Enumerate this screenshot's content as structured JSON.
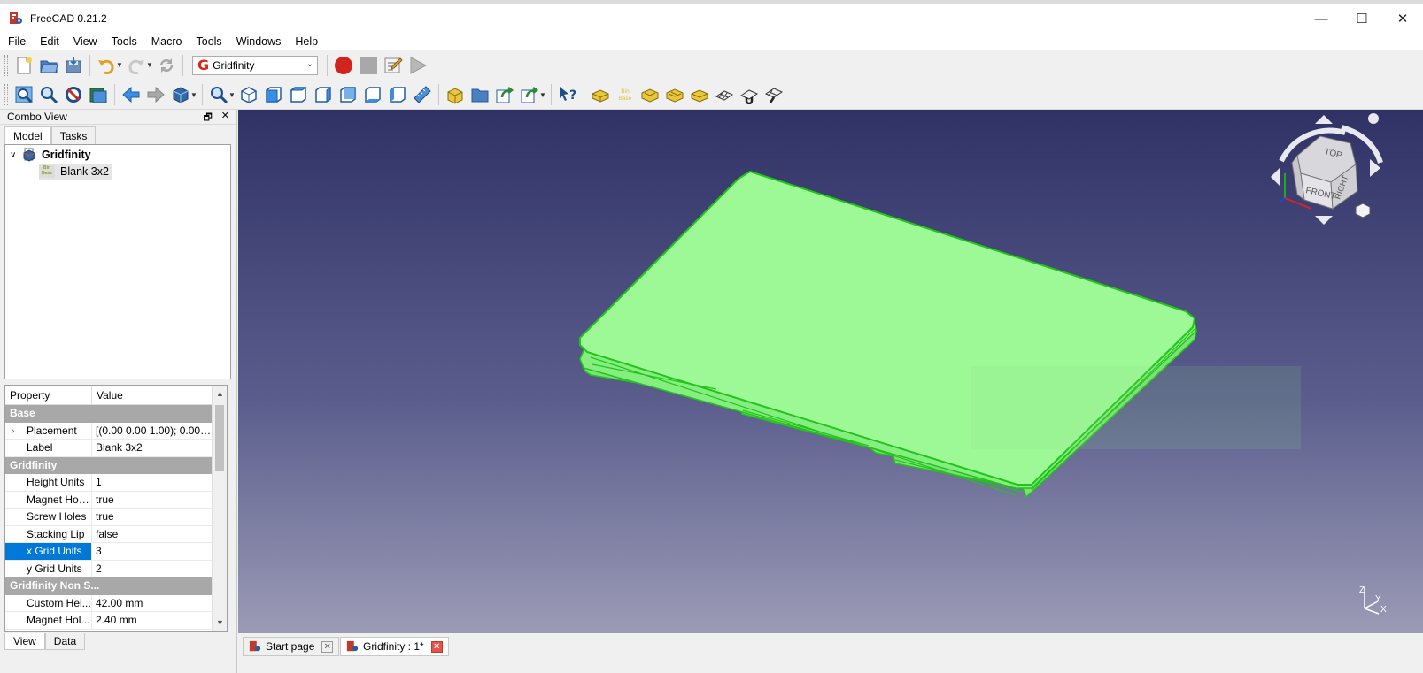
{
  "window": {
    "title": "FreeCAD 0.21.2",
    "minimize": "—",
    "maximize": "☐",
    "close": "✕"
  },
  "menu": [
    "File",
    "Edit",
    "View",
    "Tools",
    "Macro",
    "Tools",
    "Windows",
    "Help"
  ],
  "workbench": {
    "selected": "Gridfinity"
  },
  "combo": {
    "title": "Combo View",
    "tabs": [
      "Model",
      "Tasks"
    ],
    "tree": {
      "root": "Gridfinity",
      "child": "Blank 3x2",
      "child_icon_text": "Bin Base"
    }
  },
  "properties": {
    "header": {
      "property": "Property",
      "value": "Value"
    },
    "groups": [
      {
        "name": "Base",
        "rows": [
          {
            "name": "Placement",
            "value": "[(0.00 0.00 1.00); 0.00 °;...",
            "expandable": true
          },
          {
            "name": "Label",
            "value": "Blank 3x2"
          }
        ]
      },
      {
        "name": "Gridfinity",
        "rows": [
          {
            "name": "Height Units",
            "value": "1"
          },
          {
            "name": "Magnet Holes",
            "value": "true"
          },
          {
            "name": "Screw Holes",
            "value": "true"
          },
          {
            "name": "Stacking Lip",
            "value": "false"
          },
          {
            "name": "x Grid Units",
            "value": "3",
            "selected": true
          },
          {
            "name": "y Grid Units",
            "value": "2"
          }
        ]
      },
      {
        "name": "Gridfinity Non S...",
        "rows": [
          {
            "name": "Custom Hei...",
            "value": "42.00 mm"
          },
          {
            "name": "Magnet Hol...",
            "value": "2.40 mm"
          }
        ]
      }
    ]
  },
  "bottom_tabs": [
    "View",
    "Data"
  ],
  "doc_tabs": [
    {
      "label": "Start page",
      "active": false
    },
    {
      "label": "Gridfinity : 1*",
      "active": true
    }
  ],
  "navcube": {
    "top": "TOP",
    "front": "FRONT",
    "right": "RIGHT"
  },
  "axes": {
    "z": "Z",
    "y": "Y",
    "x": "X"
  },
  "colors": {
    "model_fill": "#9cf995",
    "model_edge": "#22c41a",
    "selection": "#0078d7",
    "record": "#d2231f"
  }
}
